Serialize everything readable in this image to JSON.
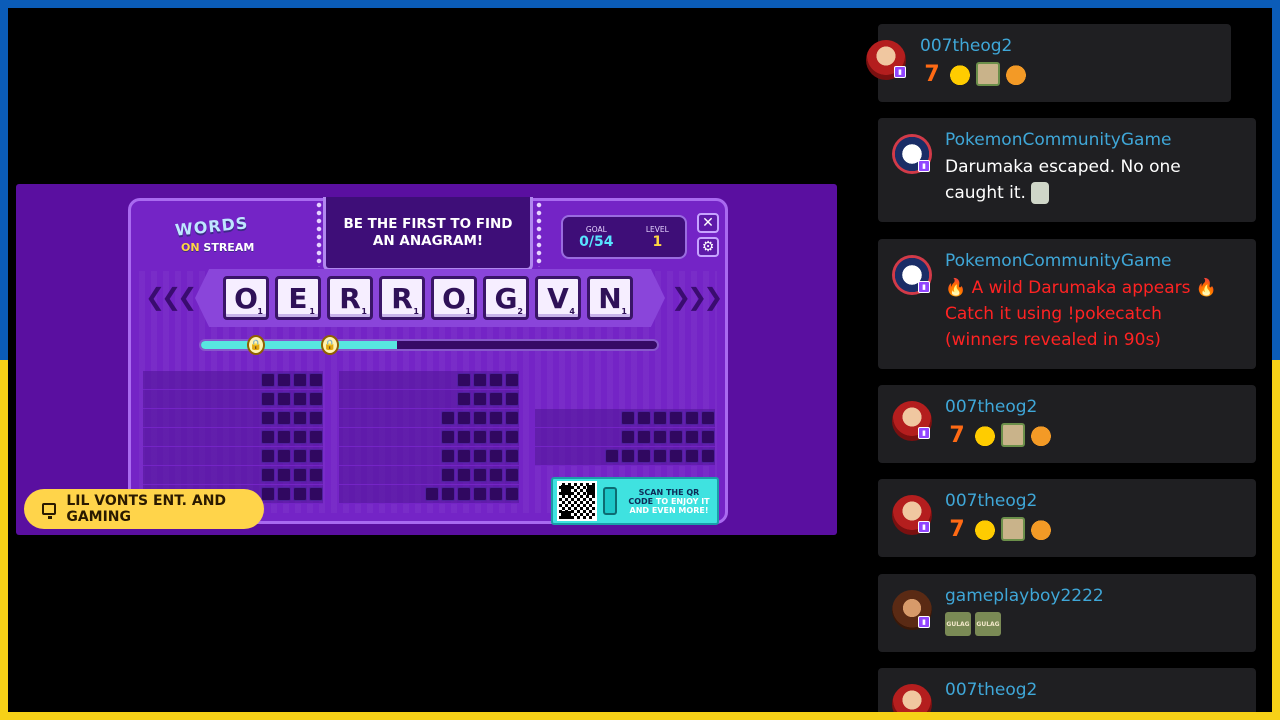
{
  "game": {
    "logo_words": "WORDS",
    "logo_on": "ON",
    "logo_stream": "STREAM",
    "prompt": "BE THE FIRST TO FIND AN ANAGRAM!",
    "goal_label": "GOAL",
    "goal_value": "0/54",
    "level_label": "LEVEL",
    "level_value": "1",
    "close_icon": "close-icon",
    "settings_icon": "gear-icon",
    "tiles": [
      {
        "letter": "O",
        "points": "1"
      },
      {
        "letter": "E",
        "points": "1"
      },
      {
        "letter": "R",
        "points": "1"
      },
      {
        "letter": "R",
        "points": "1"
      },
      {
        "letter": "O",
        "points": "1"
      },
      {
        "letter": "G",
        "points": "2"
      },
      {
        "letter": "V",
        "points": "4"
      },
      {
        "letter": "N",
        "points": "1"
      }
    ],
    "progress_fraction": 0.43,
    "qr_text_1": "SCAN THE QR",
    "qr_text_2": "CODE",
    "qr_text_3": "TO ENJOY IT",
    "qr_text_4": "AND EVEN MORE!",
    "word_slots": {
      "col1": [
        4,
        4,
        4,
        4,
        4,
        4,
        4
      ],
      "col2": [
        4,
        4,
        5,
        5,
        5,
        5,
        6
      ],
      "col3": [
        6,
        6,
        7
      ]
    }
  },
  "streamer": {
    "name": "LIL VONTS ENT. AND GAMING",
    "icon": "monitor-icon"
  },
  "chat": [
    {
      "user": "007theog2",
      "emotes": [
        "7",
        "duck",
        "face",
        "dog"
      ]
    },
    {
      "user": "PokemonCommunityGame",
      "text": "Darumaka escaped. No one caught it."
    },
    {
      "user": "PokemonCommunityGame",
      "text_line1": "A wild Darumaka appears",
      "text_line2": "Catch it using !pokecatch",
      "text_line3": "(winners revealed in 90s)"
    },
    {
      "user": "007theog2",
      "emotes": [
        "7",
        "duck",
        "face",
        "dog"
      ]
    },
    {
      "user": "007theog2",
      "emotes": [
        "7",
        "duck",
        "face",
        "dog"
      ]
    },
    {
      "user": "gameplayboy2222",
      "emotes": [
        "GULAG",
        "GULAG"
      ]
    },
    {
      "user": "007theog2"
    }
  ],
  "colors": {
    "frame_top": "#0b5cb8",
    "frame_bottom": "#f7d117",
    "game_bg": "#5a0fa0",
    "username": "#3fa7d8",
    "alert_text": "#ff2323",
    "chat_bg": "#1f1f22"
  }
}
